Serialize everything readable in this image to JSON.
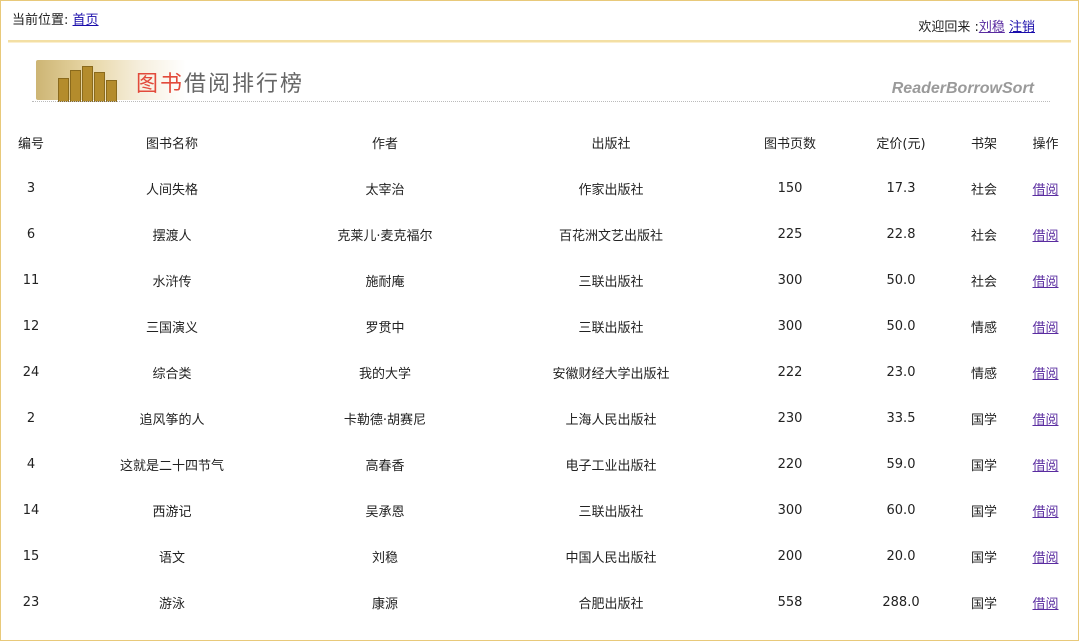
{
  "location": {
    "label": "当前位置:",
    "home_link": "首页"
  },
  "welcome": {
    "text": "欢迎回来 :",
    "user": "刘稳",
    "logout": "注销"
  },
  "banner": {
    "title_highlight": "图书",
    "title_rest": "借阅排行榜",
    "english": "ReaderBorrowSort"
  },
  "table": {
    "headers": [
      "编号",
      "图书名称",
      "作者",
      "出版社",
      "图书页数",
      "定价(元)",
      "书架",
      "操作"
    ],
    "rows": [
      [
        "3",
        "人间失格",
        "太宰治",
        "作家出版社",
        "150",
        "17.3",
        "社会",
        "借阅"
      ],
      [
        "6",
        "摆渡人",
        "克莱儿·麦克福尔",
        "百花洲文艺出版社",
        "225",
        "22.8",
        "社会",
        "借阅"
      ],
      [
        "11",
        "水浒传",
        "施耐庵",
        "三联出版社",
        "300",
        "50.0",
        "社会",
        "借阅"
      ],
      [
        "12",
        "三国演义",
        "罗贯中",
        "三联出版社",
        "300",
        "50.0",
        "情感",
        "借阅"
      ],
      [
        "24",
        "综合类",
        "我的大学",
        "安徽财经大学出版社",
        "222",
        "23.0",
        "情感",
        "借阅"
      ],
      [
        "2",
        "追风筝的人",
        "卡勒德·胡赛尼",
        "上海人民出版社",
        "230",
        "33.5",
        "国学",
        "借阅"
      ],
      [
        "4",
        "这就是二十四节气",
        "高春香",
        "电子工业出版社",
        "220",
        "59.0",
        "国学",
        "借阅"
      ],
      [
        "14",
        "西游记",
        "吴承恩",
        "三联出版社",
        "300",
        "60.0",
        "国学",
        "借阅"
      ],
      [
        "15",
        "语文",
        "刘稳",
        "中国人民出版社",
        "200",
        "20.0",
        "国学",
        "借阅"
      ],
      [
        "23",
        "游泳",
        "康源",
        "合肥出版社",
        "558",
        "288.0",
        "国学",
        "借阅"
      ]
    ]
  }
}
